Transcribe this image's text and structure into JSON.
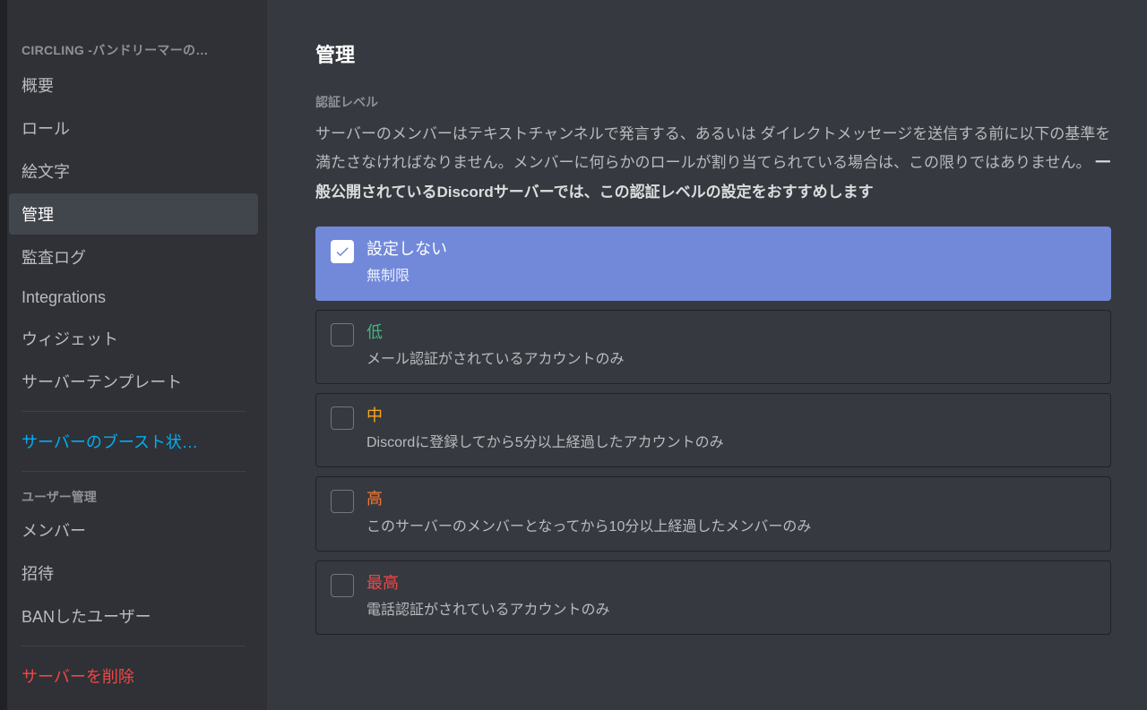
{
  "sidebar": {
    "server_name": "CIRCLING -バンドリーマーの…",
    "items_main": [
      {
        "key": "overview",
        "label": "概要"
      },
      {
        "key": "roles",
        "label": "ロール"
      },
      {
        "key": "emoji",
        "label": "絵文字"
      },
      {
        "key": "moderation",
        "label": "管理",
        "active": true
      },
      {
        "key": "audit",
        "label": "監査ログ"
      },
      {
        "key": "integrations",
        "label": "Integrations"
      },
      {
        "key": "widget",
        "label": "ウィジェット"
      },
      {
        "key": "template",
        "label": "サーバーテンプレート"
      }
    ],
    "boost_label": "サーバーのブースト状…",
    "user_mgmt_header": "ユーザー管理",
    "items_user": [
      {
        "key": "members",
        "label": "メンバー"
      },
      {
        "key": "invites",
        "label": "招待"
      },
      {
        "key": "bans",
        "label": "BANしたユーザー"
      }
    ],
    "delete_label": "サーバーを削除"
  },
  "main": {
    "title": "管理",
    "section_label": "認証レベル",
    "desc_plain": "サーバーのメンバーはテキストチャンネルで発言する、あるいは ダイレクトメッセージを送信する前に以下の基準を満たさなければなりません。メンバーに何らかのロールが割り当てられている場合は、この限りではありません。 ",
    "desc_bold": "一般公開されているDiscordサーバーでは、この認証レベルの設定をおすすめします",
    "options": [
      {
        "key": "none",
        "title": "設定しない",
        "desc": "無制限",
        "selected": true,
        "color": "clr-none"
      },
      {
        "key": "low",
        "title": "低",
        "desc": "メール認証がされているアカウントのみ",
        "selected": false,
        "color": "clr-low"
      },
      {
        "key": "medium",
        "title": "中",
        "desc": "Discordに登録してから5分以上経過したアカウントのみ",
        "selected": false,
        "color": "clr-medium"
      },
      {
        "key": "high",
        "title": "高",
        "desc": "このサーバーのメンバーとなってから10分以上経過したメンバーのみ",
        "selected": false,
        "color": "clr-high"
      },
      {
        "key": "highest",
        "title": "最高",
        "desc": "電話認証がされているアカウントのみ",
        "selected": false,
        "color": "clr-highest"
      }
    ]
  }
}
